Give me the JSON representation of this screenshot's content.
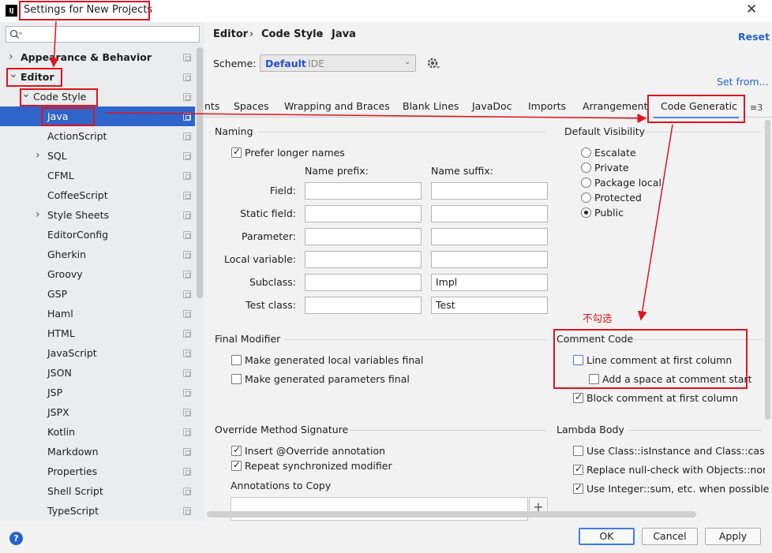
{
  "window": {
    "title": "Settings for New Projects",
    "app_icon_text": "IJ"
  },
  "search": {
    "placeholder": ""
  },
  "sidebar": {
    "items": [
      {
        "label": "Appearance & Behavior",
        "level": 0,
        "arrow": "›",
        "bold": true
      },
      {
        "label": "Editor",
        "level": 0,
        "arrow": "⌄",
        "bold": true
      },
      {
        "label": "Code Style",
        "level": 1,
        "arrow": "⌄"
      },
      {
        "label": "Java",
        "level": 2,
        "selected": true
      },
      {
        "label": "ActionScript",
        "level": 2
      },
      {
        "label": "SQL",
        "level": 2,
        "arrow": "›"
      },
      {
        "label": "CFML",
        "level": 2
      },
      {
        "label": "CoffeeScript",
        "level": 2
      },
      {
        "label": "Style Sheets",
        "level": 2,
        "arrow": "›"
      },
      {
        "label": "EditorConfig",
        "level": 2
      },
      {
        "label": "Gherkin",
        "level": 2
      },
      {
        "label": "Groovy",
        "level": 2
      },
      {
        "label": "GSP",
        "level": 2
      },
      {
        "label": "Haml",
        "level": 2
      },
      {
        "label": "HTML",
        "level": 2
      },
      {
        "label": "JavaScript",
        "level": 2
      },
      {
        "label": "JSON",
        "level": 2
      },
      {
        "label": "JSP",
        "level": 2
      },
      {
        "label": "JSPX",
        "level": 2
      },
      {
        "label": "Kotlin",
        "level": 2
      },
      {
        "label": "Markdown",
        "level": 2
      },
      {
        "label": "Properties",
        "level": 2
      },
      {
        "label": "Shell Script",
        "level": 2
      },
      {
        "label": "TypeScript",
        "level": 2
      }
    ]
  },
  "breadcrumb": {
    "parts": [
      "Editor",
      "Code Style",
      "Java"
    ],
    "sep": "›"
  },
  "reset_label": "Reset",
  "scheme": {
    "label": "Scheme:",
    "value": "Default",
    "suffix": "IDE"
  },
  "set_from_label": "Set from...",
  "tabs": [
    "nts",
    "Spaces",
    "Wrapping and Braces",
    "Blank Lines",
    "JavaDoc",
    "Imports",
    "Arrangement",
    "Code Generatic"
  ],
  "tabs_more": "≡3",
  "naming": {
    "title": "Naming",
    "prefer_longer": {
      "label": "Prefer longer names",
      "checked": true
    },
    "prefix_header": "Name prefix:",
    "suffix_header": "Name suffix:",
    "rows": [
      {
        "label": "Field:",
        "prefix": "",
        "suffix": ""
      },
      {
        "label": "Static field:",
        "prefix": "",
        "suffix": ""
      },
      {
        "label": "Parameter:",
        "prefix": "",
        "suffix": ""
      },
      {
        "label": "Local variable:",
        "prefix": "",
        "suffix": ""
      },
      {
        "label": "Subclass:",
        "prefix": "",
        "suffix": "Impl"
      },
      {
        "label": "Test class:",
        "prefix": "",
        "suffix": "Test"
      }
    ]
  },
  "default_visibility": {
    "title": "Default Visibility",
    "options": [
      "Escalate",
      "Private",
      "Package local",
      "Protected",
      "Public"
    ],
    "selected": "Public"
  },
  "final_modifier": {
    "title": "Final Modifier",
    "options": [
      {
        "label": "Make generated local variables final",
        "checked": false
      },
      {
        "label": "Make generated parameters final",
        "checked": false
      }
    ]
  },
  "comment_code": {
    "title": "Comment Code",
    "annotation": "不勾选",
    "options": [
      {
        "label": "Line comment at first column",
        "checked": false
      },
      {
        "label": "Add a space at comment start",
        "checked": false
      },
      {
        "label": "Block comment at first column",
        "checked": true
      }
    ]
  },
  "override": {
    "title": "Override Method Signature",
    "options": [
      {
        "label": "Insert @Override annotation",
        "checked": true
      },
      {
        "label": "Repeat synchronized modifier",
        "checked": true
      }
    ],
    "annotations_label": "Annotations to Copy",
    "add_label": "+"
  },
  "lambda": {
    "title": "Lambda Body",
    "options": [
      {
        "label": "Use Class::isInstance and Class::cast whe",
        "checked": false
      },
      {
        "label": "Replace null-check with Objects::nonNull",
        "checked": true
      },
      {
        "label": "Use Integer::sum, etc. when possible",
        "checked": true
      }
    ]
  },
  "footer": {
    "help": "?",
    "ok": "OK",
    "cancel": "Cancel",
    "apply": "Apply"
  },
  "colors": {
    "selection": "#2f65ca",
    "link": "#2463c9",
    "annotation_red": "#e0141e",
    "tab_underline": "#4a88e3"
  }
}
